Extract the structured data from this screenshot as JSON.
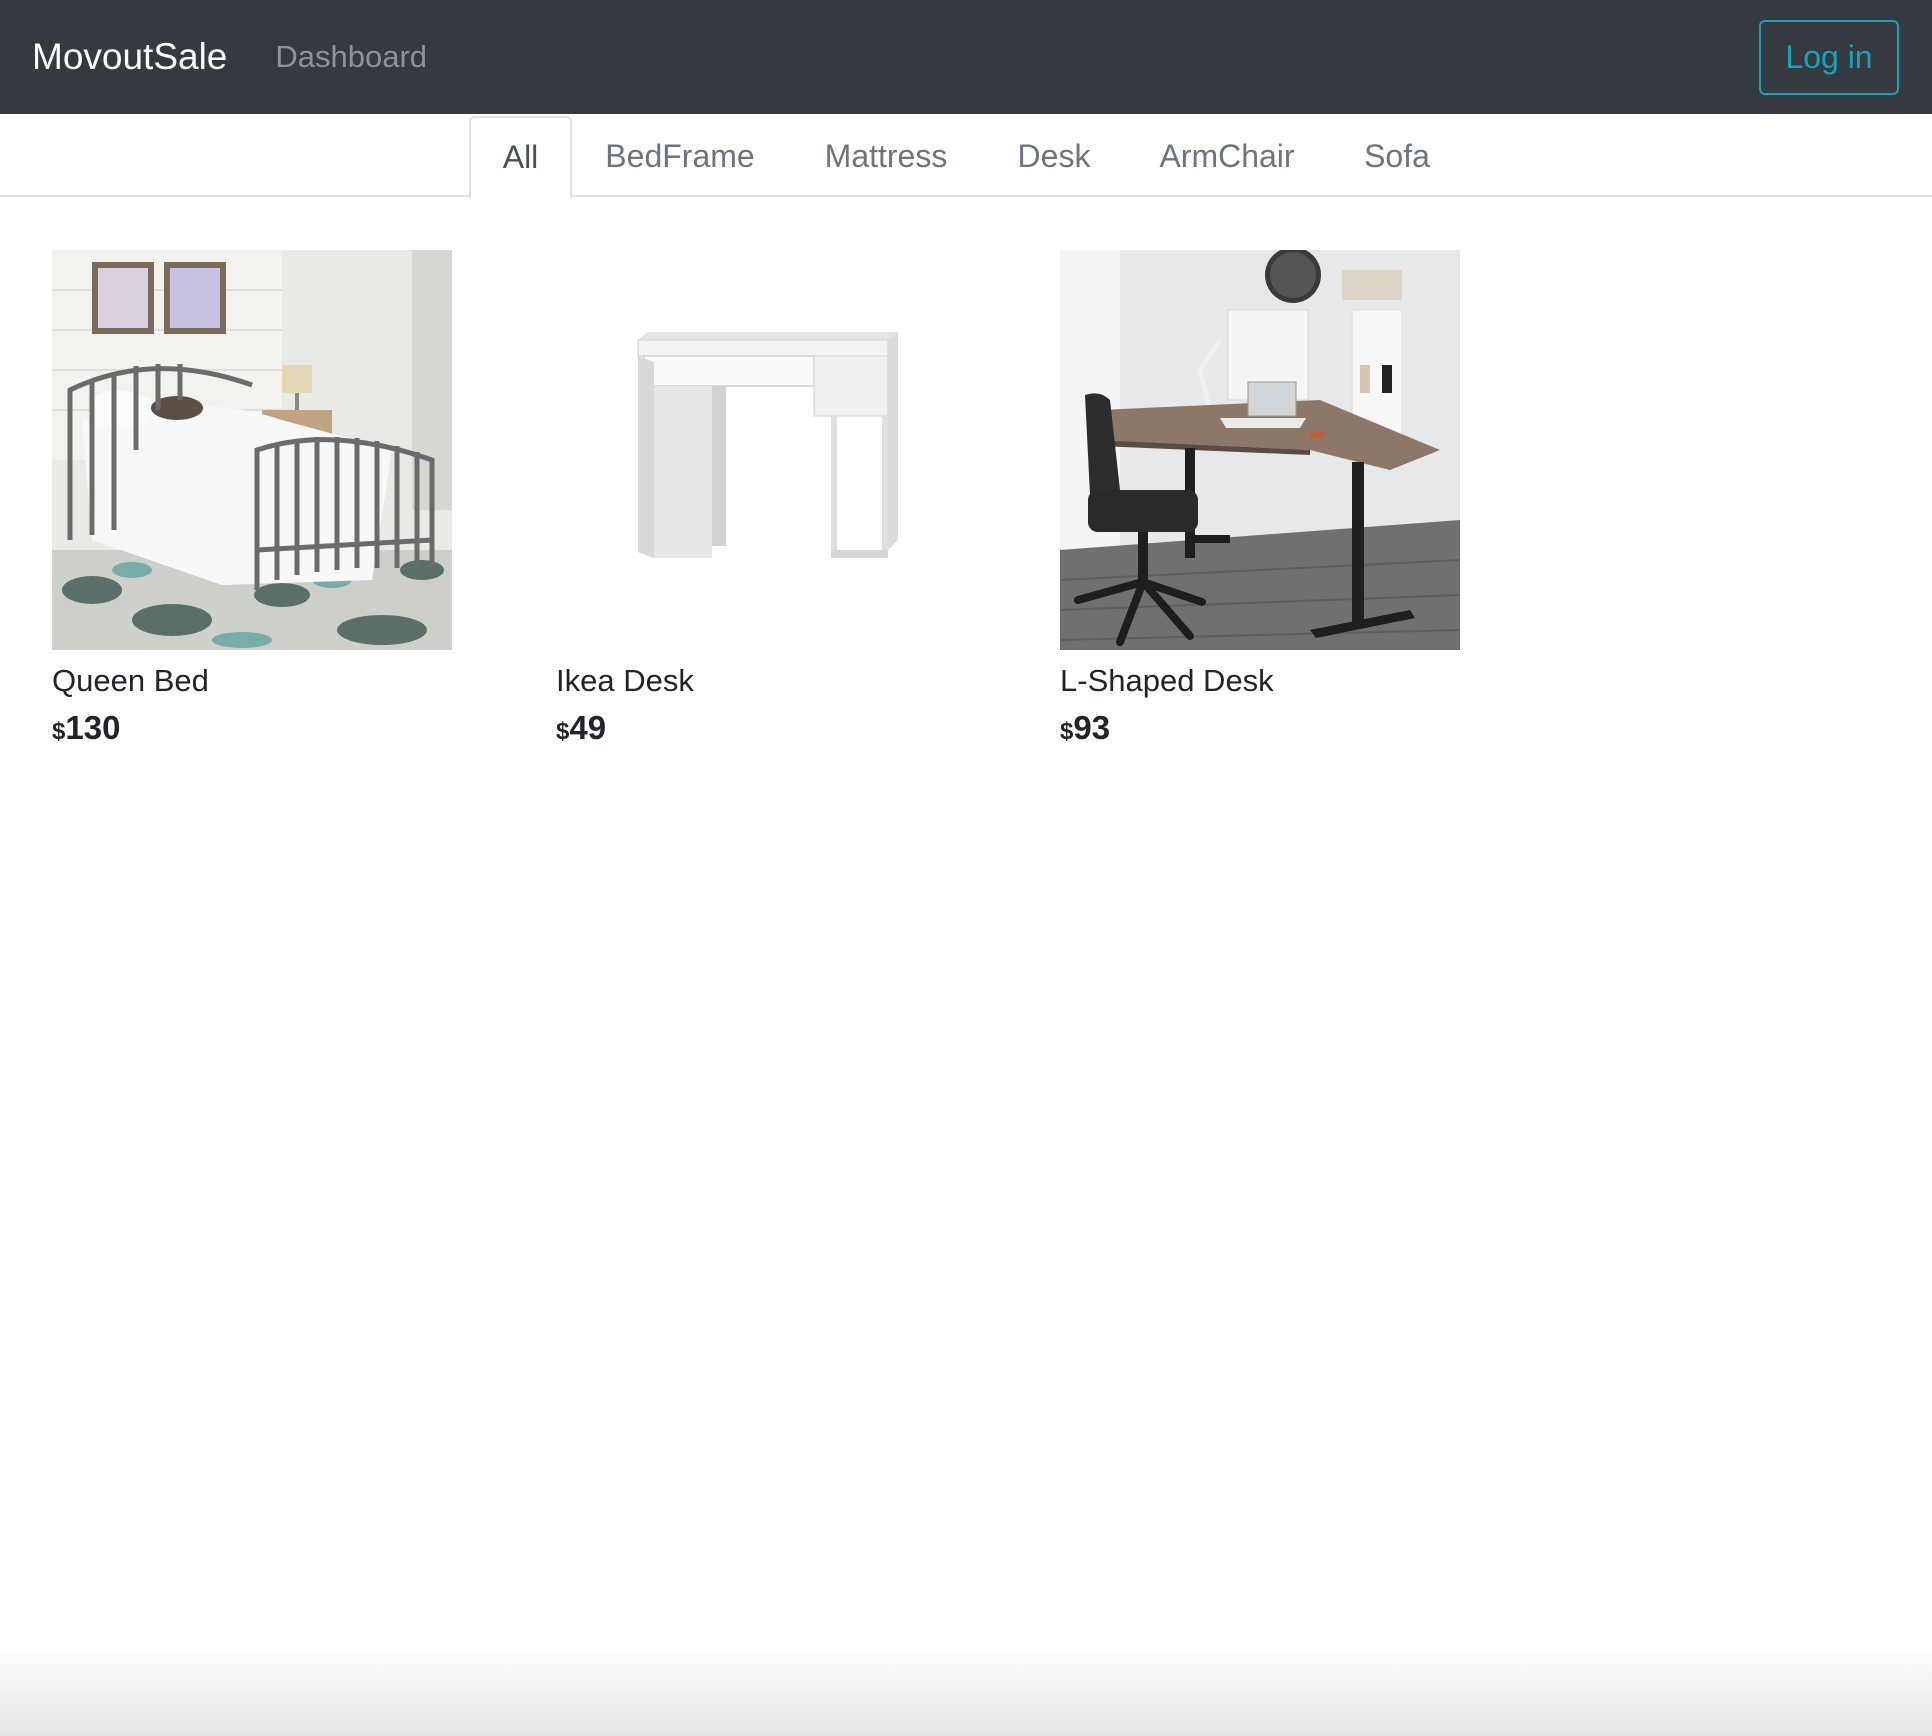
{
  "navbar": {
    "brand": "MovoutSale",
    "dashboard_link": "Dashboard",
    "login_label": "Log in",
    "background": "#343a40",
    "accent": "#17a2b8"
  },
  "tabs": [
    {
      "label": "All",
      "active": true
    },
    {
      "label": "BedFrame",
      "active": false
    },
    {
      "label": "Mattress",
      "active": false
    },
    {
      "label": "Desk",
      "active": false
    },
    {
      "label": "ArmChair",
      "active": false
    },
    {
      "label": "Sofa",
      "active": false
    }
  ],
  "listings": [
    {
      "title": "Queen Bed",
      "currency": "$",
      "price": "130",
      "image": "bed-photo"
    },
    {
      "title": "Ikea Desk",
      "currency": "$",
      "price": "49",
      "image": "white-desk-photo"
    },
    {
      "title": "L-Shaped Desk",
      "currency": "$",
      "price": "93",
      "image": "l-shaped-desk-photo"
    }
  ]
}
